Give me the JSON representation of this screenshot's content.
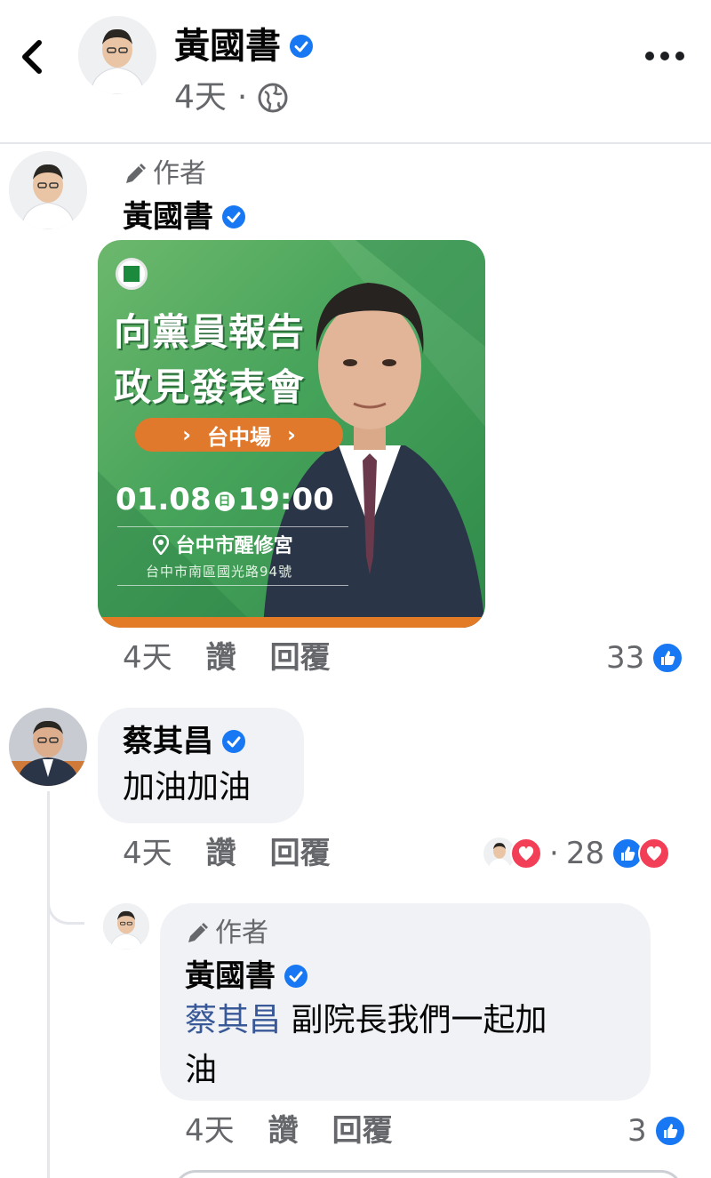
{
  "header": {
    "page_name": "黃國書",
    "time": "4天",
    "separator": "·",
    "icons": {
      "back": "chevron-left-icon",
      "privacy": "globe-icon",
      "more": "more-dots-icon",
      "verified": "verified-badge-icon"
    }
  },
  "post": {
    "author_label": "作者",
    "author_name": "黃國書",
    "image": {
      "title_line1": "向黨員報告",
      "title_line2": "政見發表會",
      "event": "台中場",
      "date": "01.08",
      "day_mark": "日",
      "time": "19:00",
      "venue": "台中市醒修宮",
      "address": "台中市南區國光路94號"
    },
    "meta": {
      "time": "4天",
      "like": "讚",
      "reply": "回覆"
    },
    "reactions_count": "33"
  },
  "comment": {
    "author_name": "蔡其昌",
    "text": "加油加油",
    "meta": {
      "time": "4天",
      "like": "讚",
      "reply": "回覆"
    },
    "reactions_prefix": "·",
    "reactions_count": "28"
  },
  "reply": {
    "author_label": "作者",
    "author_name": "黃國書",
    "mention": "蔡其昌",
    "text_after_mention": " 副院長我們一起加",
    "text_line2": "油",
    "meta": {
      "time": "4天",
      "like": "讚",
      "reply": "回覆"
    },
    "reactions_count": "3"
  },
  "colors": {
    "brand_blue": "#1877f2",
    "love_red": "#f33e58",
    "poster_green": "#46a35a",
    "poster_orange": "#e0792c",
    "meta_gray": "#65676b"
  }
}
